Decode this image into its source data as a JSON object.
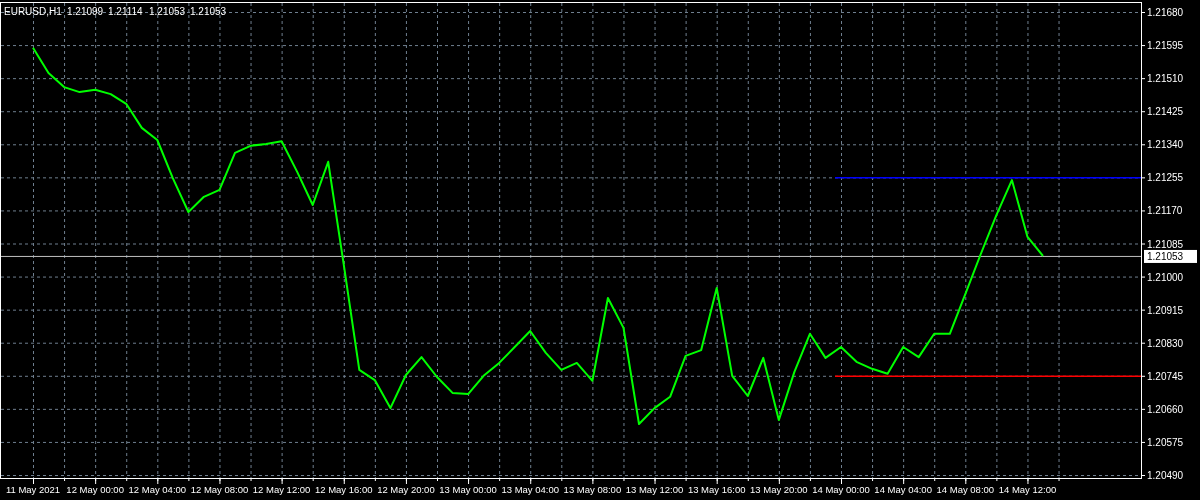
{
  "chart_header": {
    "symbol": "EURUSD,H1",
    "prices": [
      "1.21099",
      "1.21114",
      "1.21053",
      "1.21053"
    ]
  },
  "chart": {
    "chart_data": {
      "type": "line",
      "categories": [
        "11 May 2021",
        null,
        null,
        null,
        "12 May 00:00",
        null,
        null,
        null,
        "12 May 04:00",
        null,
        null,
        null,
        "12 May 08:00",
        null,
        null,
        null,
        "12 May 12:00",
        null,
        null,
        null,
        "12 May 16:00",
        null,
        null,
        null,
        "12 May 20:00",
        null,
        null,
        null,
        "13 May 00:00",
        null,
        null,
        null,
        "13 May 04:00",
        null,
        null,
        null,
        "13 May 08:00",
        null,
        null,
        null,
        "13 May 12:00",
        null,
        null,
        null,
        "13 May 16:00",
        null,
        null,
        null,
        "13 May 20:00",
        null,
        null,
        null,
        "14 May 00:00",
        null,
        null,
        null,
        "14 May 04:00",
        null,
        null,
        null,
        "14 May 08:00",
        null,
        null,
        null,
        "14 May 12:00",
        null
      ],
      "series": [
        {
          "color": "#00ff00",
          "values": [
            1.21588,
            1.21523,
            1.21487,
            1.21474,
            1.2148,
            1.21469,
            1.21444,
            1.21382,
            1.21351,
            1.21253,
            1.21166,
            1.21205,
            1.21223,
            1.21318,
            1.21336,
            1.21341,
            1.21348,
            1.21269,
            1.21184,
            1.21295,
            1.2103,
            1.2076,
            1.20734,
            1.20662,
            1.20747,
            1.20793,
            1.20742,
            1.20701,
            1.20698,
            1.20745,
            1.20778,
            1.20819,
            1.2086,
            1.20804,
            1.2076,
            1.20778,
            1.20732,
            1.20945,
            1.20868,
            1.20621,
            1.20662,
            1.20691,
            1.20796,
            1.20811,
            1.20971,
            1.20745,
            1.20693,
            1.20791,
            1.20631,
            1.20755,
            1.20853,
            1.20791,
            1.20819,
            1.20781,
            1.20763,
            1.2075,
            1.20819,
            1.20793,
            1.20853,
            1.20853,
            1.20955,
            1.21058,
            1.21158,
            1.21248,
            1.21102,
            1.21053
          ]
        }
      ],
      "ylim": [
        1.2049,
        1.2168
      ],
      "grid": true,
      "yticks": [
        {
          "value": 1.2168,
          "label": "1.21680"
        },
        {
          "value": 1.21595,
          "label": "1.21595"
        },
        {
          "value": 1.2151,
          "label": "1.21510"
        },
        {
          "value": 1.21425,
          "label": "1.21425"
        },
        {
          "value": 1.2134,
          "label": "1.21340"
        },
        {
          "value": 1.21255,
          "label": "1.21255"
        },
        {
          "value": 1.2117,
          "label": "1.21170"
        },
        {
          "value": 1.21085,
          "label": "1.21085"
        },
        {
          "value": 1.21,
          "label": "1.21000"
        },
        {
          "value": 1.20915,
          "label": "1.20915"
        },
        {
          "value": 1.2083,
          "label": "1.20830"
        },
        {
          "value": 1.20745,
          "label": "1.20745"
        },
        {
          "value": 1.2066,
          "label": "1.20660"
        },
        {
          "value": 1.20575,
          "label": "1.20575"
        },
        {
          "value": 1.2049,
          "label": "1.20490"
        }
      ],
      "ref_lines": [
        {
          "axis": "y",
          "value": 1.21255,
          "color": "#0000ff"
        },
        {
          "axis": "y",
          "value": 1.20745,
          "color": "#ff0000"
        },
        {
          "axis": "y",
          "value": 1.21053,
          "label": "1.21053",
          "color": "#c0c0c0"
        }
      ]
    }
  }
}
